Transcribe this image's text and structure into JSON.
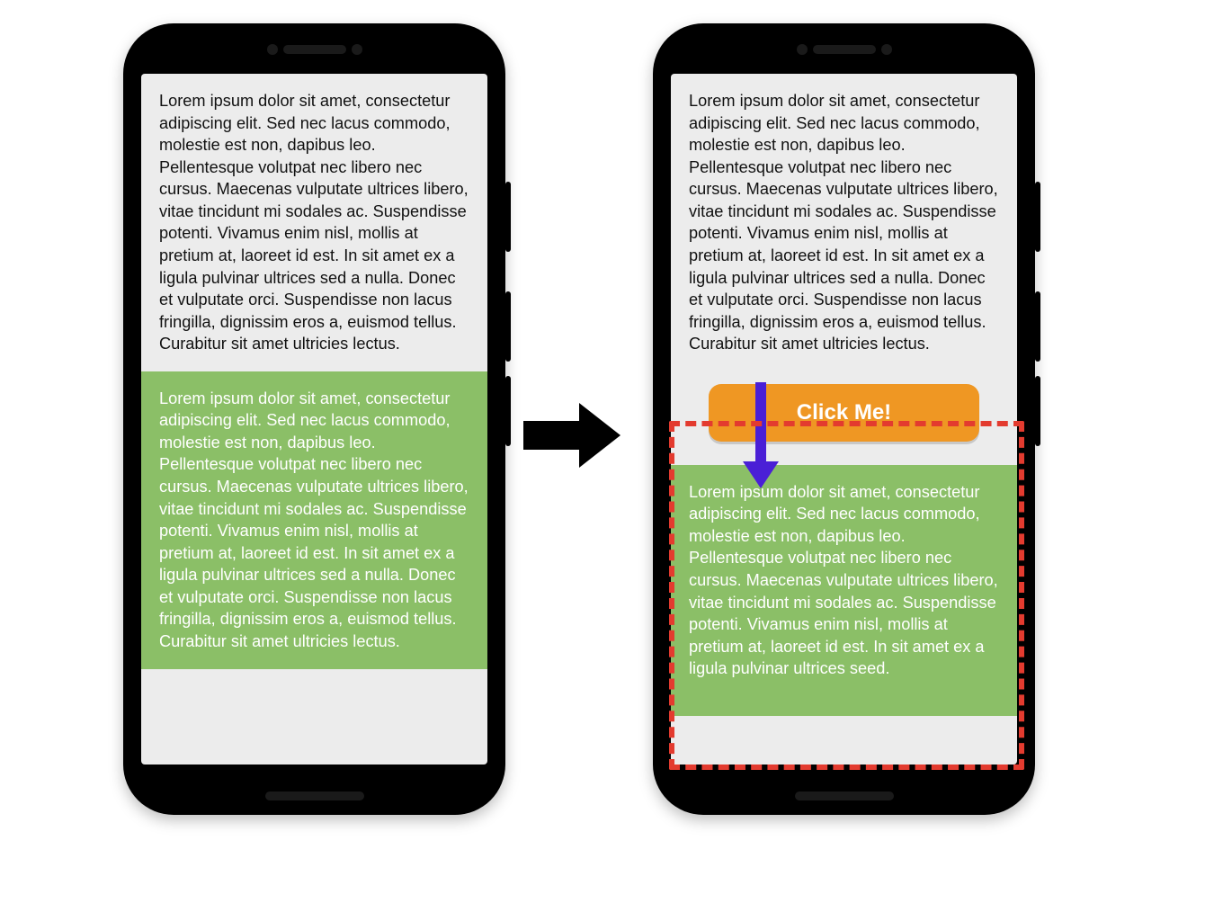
{
  "body_text": "Lorem ipsum dolor sit amet, consectetur adipiscing elit. Sed nec lacus commodo, molestie est non, dapibus leo. Pellentesque volutpat nec libero nec cursus. Maecenas vulputate ultrices libero, vitae tincidunt mi sodales ac. Suspendisse potenti. Vivamus enim nisl, mollis at pretium at, laoreet id est. In sit amet ex a ligula pulvinar ultrices sed a nulla. Donec et vulputate orci. Suspendisse non lacus fringilla, dignissim eros a, euismod tellus. Curabitur sit amet ultricies lectus.",
  "body_text_green_truncated": "Lorem ipsum dolor sit amet, consectetur adipiscing elit. Sed nec lacus commodo, molestie est non, dapibus leo. Pellentesque volutpat nec libero nec cursus. Maecenas vulputate ultrices libero, vitae tincidunt mi sodales ac. Suspendisse potenti. Vivamus enim nisl, mollis at pretium at, laoreet id est. In sit amet ex a ligula pulvinar ultrices seed.",
  "cta_label": "Click Me!",
  "colors": {
    "green_block": "#8bbf67",
    "cta_orange": "#ef9723",
    "highlight_red": "#e33b2f",
    "arrow_purple": "#4a1fd6"
  }
}
